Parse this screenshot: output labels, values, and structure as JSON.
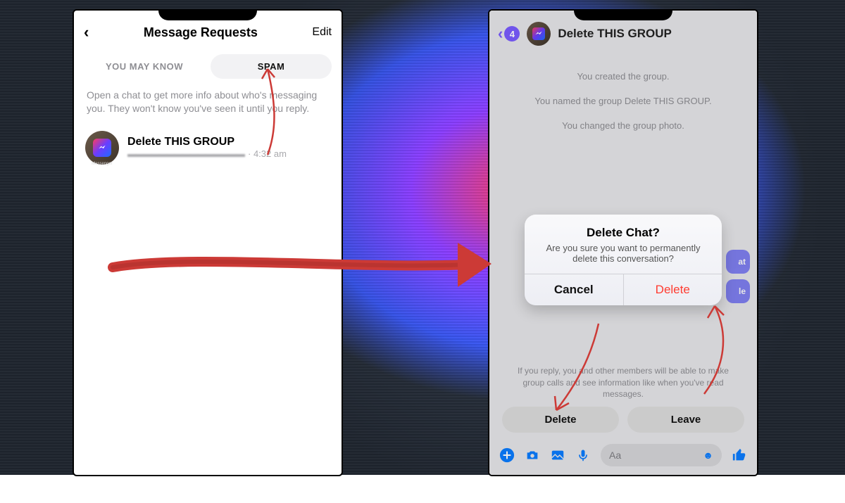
{
  "left_phone": {
    "header": {
      "title": "Message Requests",
      "edit": "Edit"
    },
    "tabs": {
      "you_may_know": "YOU MAY KNOW",
      "spam": "SPAM"
    },
    "info_text": "Open a chat to get more info about who's messaging you. They won't know you've seen it until you reply.",
    "chat": {
      "name": "Delete THIS GROUP",
      "preview_suffix": "· 4:32 am",
      "avatar_caption": "Messenger"
    }
  },
  "right_phone": {
    "back_badge": "4",
    "title": "Delete THIS GROUP",
    "system_messages": [
      "You created the group.",
      "You named the group Delete THIS GROUP.",
      "You changed the group photo."
    ],
    "side_actions": {
      "chat_partial": "at",
      "people_partial": "le"
    },
    "footer_note": "If you reply, you and other members will be able to make group calls and see information like when you've read messages.",
    "buttons": {
      "delete": "Delete",
      "leave": "Leave"
    },
    "composer": {
      "placeholder": "Aa"
    },
    "modal": {
      "title": "Delete Chat?",
      "message": "Are you sure you want to permanently delete this conversation?",
      "cancel": "Cancel",
      "delete": "Delete"
    }
  },
  "annotation_colors": {
    "red": "#cc3a36"
  }
}
